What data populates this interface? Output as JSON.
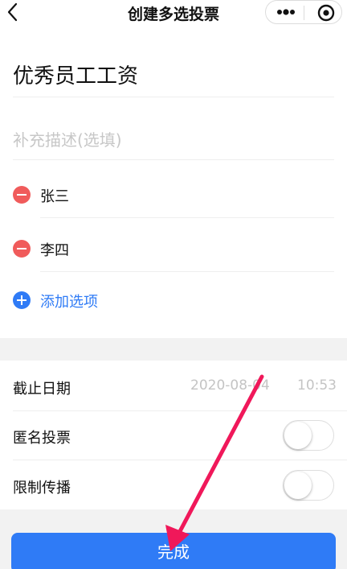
{
  "navbar": {
    "title": "创建多选投票",
    "back_icon": "chevron-left-icon",
    "more_icon": "more-dots-icon",
    "close_icon": "target-circle-icon"
  },
  "form": {
    "title_value": "优秀员工工资",
    "description_placeholder": "补充描述(选填)",
    "options": [
      {
        "label": "张三",
        "icon": "remove-circle-icon"
      },
      {
        "label": "李四",
        "icon": "remove-circle-icon"
      }
    ],
    "add_option_label": "添加选项"
  },
  "settings": {
    "deadline_label": "截止日期",
    "deadline_date": "2020-08-04",
    "deadline_time": "10:53",
    "anonymous_label": "匿名投票",
    "anonymous_on": false,
    "limit_share_label": "限制传播",
    "limit_share_on": false
  },
  "footer": {
    "done_label": "完成"
  },
  "colors": {
    "accent_blue": "#2f7bf6",
    "remove_red": "#f05b5b",
    "annotation_arrow": "#f0185a"
  }
}
